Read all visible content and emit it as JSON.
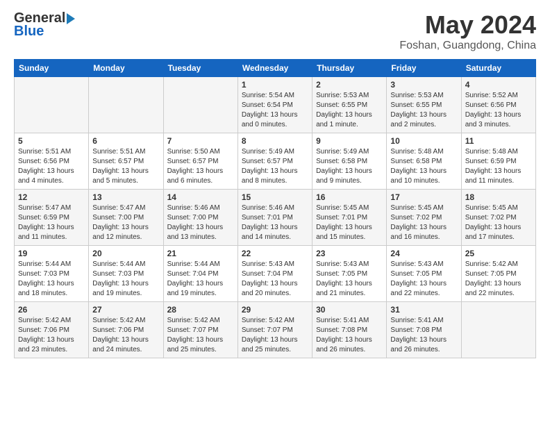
{
  "logo": {
    "general": "General",
    "blue": "Blue"
  },
  "title": "May 2024",
  "subtitle": "Foshan, Guangdong, China",
  "weekdays": [
    "Sunday",
    "Monday",
    "Tuesday",
    "Wednesday",
    "Thursday",
    "Friday",
    "Saturday"
  ],
  "weeks": [
    [
      {
        "day": "",
        "info": ""
      },
      {
        "day": "",
        "info": ""
      },
      {
        "day": "",
        "info": ""
      },
      {
        "day": "1",
        "info": "Sunrise: 5:54 AM\nSunset: 6:54 PM\nDaylight: 13 hours\nand 0 minutes."
      },
      {
        "day": "2",
        "info": "Sunrise: 5:53 AM\nSunset: 6:55 PM\nDaylight: 13 hours\nand 1 minute."
      },
      {
        "day": "3",
        "info": "Sunrise: 5:53 AM\nSunset: 6:55 PM\nDaylight: 13 hours\nand 2 minutes."
      },
      {
        "day": "4",
        "info": "Sunrise: 5:52 AM\nSunset: 6:56 PM\nDaylight: 13 hours\nand 3 minutes."
      }
    ],
    [
      {
        "day": "5",
        "info": "Sunrise: 5:51 AM\nSunset: 6:56 PM\nDaylight: 13 hours\nand 4 minutes."
      },
      {
        "day": "6",
        "info": "Sunrise: 5:51 AM\nSunset: 6:57 PM\nDaylight: 13 hours\nand 5 minutes."
      },
      {
        "day": "7",
        "info": "Sunrise: 5:50 AM\nSunset: 6:57 PM\nDaylight: 13 hours\nand 6 minutes."
      },
      {
        "day": "8",
        "info": "Sunrise: 5:49 AM\nSunset: 6:57 PM\nDaylight: 13 hours\nand 8 minutes."
      },
      {
        "day": "9",
        "info": "Sunrise: 5:49 AM\nSunset: 6:58 PM\nDaylight: 13 hours\nand 9 minutes."
      },
      {
        "day": "10",
        "info": "Sunrise: 5:48 AM\nSunset: 6:58 PM\nDaylight: 13 hours\nand 10 minutes."
      },
      {
        "day": "11",
        "info": "Sunrise: 5:48 AM\nSunset: 6:59 PM\nDaylight: 13 hours\nand 11 minutes."
      }
    ],
    [
      {
        "day": "12",
        "info": "Sunrise: 5:47 AM\nSunset: 6:59 PM\nDaylight: 13 hours\nand 11 minutes."
      },
      {
        "day": "13",
        "info": "Sunrise: 5:47 AM\nSunset: 7:00 PM\nDaylight: 13 hours\nand 12 minutes."
      },
      {
        "day": "14",
        "info": "Sunrise: 5:46 AM\nSunset: 7:00 PM\nDaylight: 13 hours\nand 13 minutes."
      },
      {
        "day": "15",
        "info": "Sunrise: 5:46 AM\nSunset: 7:01 PM\nDaylight: 13 hours\nand 14 minutes."
      },
      {
        "day": "16",
        "info": "Sunrise: 5:45 AM\nSunset: 7:01 PM\nDaylight: 13 hours\nand 15 minutes."
      },
      {
        "day": "17",
        "info": "Sunrise: 5:45 AM\nSunset: 7:02 PM\nDaylight: 13 hours\nand 16 minutes."
      },
      {
        "day": "18",
        "info": "Sunrise: 5:45 AM\nSunset: 7:02 PM\nDaylight: 13 hours\nand 17 minutes."
      }
    ],
    [
      {
        "day": "19",
        "info": "Sunrise: 5:44 AM\nSunset: 7:03 PM\nDaylight: 13 hours\nand 18 minutes."
      },
      {
        "day": "20",
        "info": "Sunrise: 5:44 AM\nSunset: 7:03 PM\nDaylight: 13 hours\nand 19 minutes."
      },
      {
        "day": "21",
        "info": "Sunrise: 5:44 AM\nSunset: 7:04 PM\nDaylight: 13 hours\nand 19 minutes."
      },
      {
        "day": "22",
        "info": "Sunrise: 5:43 AM\nSunset: 7:04 PM\nDaylight: 13 hours\nand 20 minutes."
      },
      {
        "day": "23",
        "info": "Sunrise: 5:43 AM\nSunset: 7:05 PM\nDaylight: 13 hours\nand 21 minutes."
      },
      {
        "day": "24",
        "info": "Sunrise: 5:43 AM\nSunset: 7:05 PM\nDaylight: 13 hours\nand 22 minutes."
      },
      {
        "day": "25",
        "info": "Sunrise: 5:42 AM\nSunset: 7:05 PM\nDaylight: 13 hours\nand 22 minutes."
      }
    ],
    [
      {
        "day": "26",
        "info": "Sunrise: 5:42 AM\nSunset: 7:06 PM\nDaylight: 13 hours\nand 23 minutes."
      },
      {
        "day": "27",
        "info": "Sunrise: 5:42 AM\nSunset: 7:06 PM\nDaylight: 13 hours\nand 24 minutes."
      },
      {
        "day": "28",
        "info": "Sunrise: 5:42 AM\nSunset: 7:07 PM\nDaylight: 13 hours\nand 25 minutes."
      },
      {
        "day": "29",
        "info": "Sunrise: 5:42 AM\nSunset: 7:07 PM\nDaylight: 13 hours\nand 25 minutes."
      },
      {
        "day": "30",
        "info": "Sunrise: 5:41 AM\nSunset: 7:08 PM\nDaylight: 13 hours\nand 26 minutes."
      },
      {
        "day": "31",
        "info": "Sunrise: 5:41 AM\nSunset: 7:08 PM\nDaylight: 13 hours\nand 26 minutes."
      },
      {
        "day": "",
        "info": ""
      }
    ]
  ]
}
